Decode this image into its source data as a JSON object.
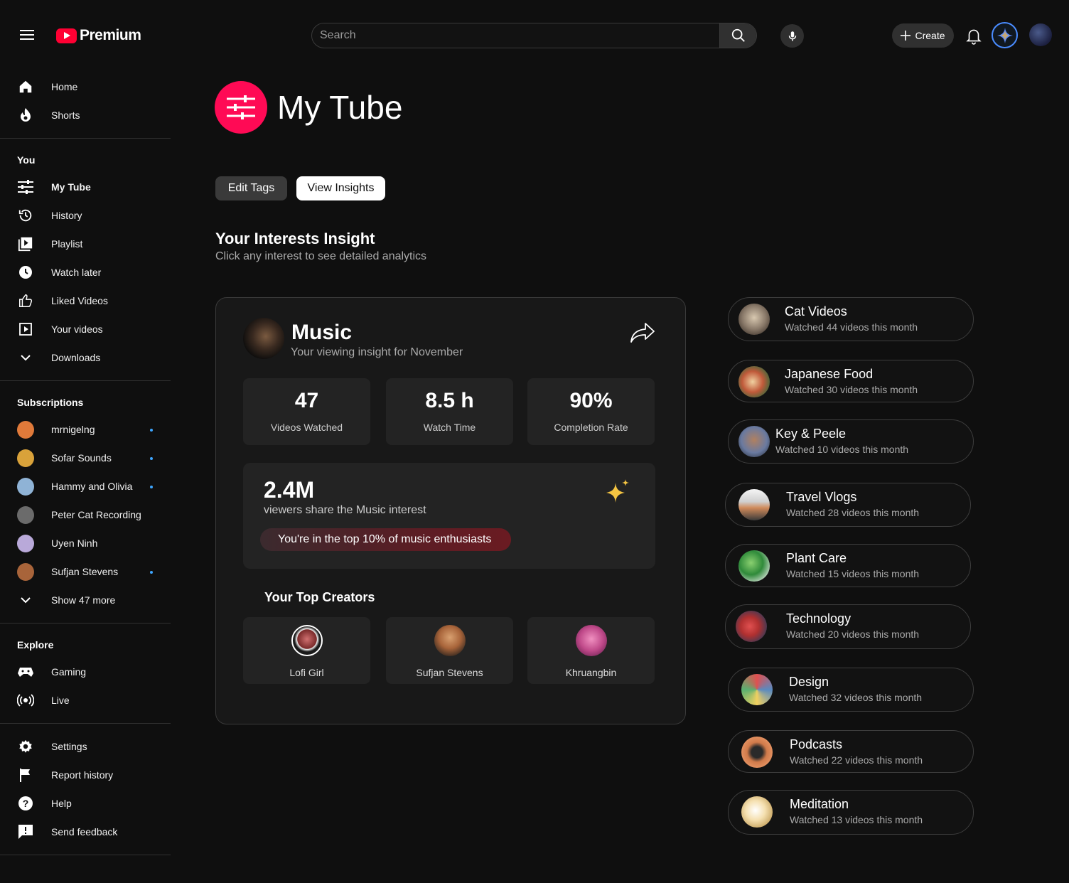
{
  "topbar": {
    "brand": "Premium",
    "search_placeholder": "Search",
    "create_label": "Create"
  },
  "sidebar": {
    "top": [
      {
        "label": "Home",
        "icon": "home-icon"
      },
      {
        "label": "Shorts",
        "icon": "shorts-icon"
      }
    ],
    "you_title": "You",
    "you": [
      {
        "label": "My Tube",
        "icon": "sliders-icon",
        "active": true
      },
      {
        "label": "History",
        "icon": "history-icon"
      },
      {
        "label": "Playlist",
        "icon": "playlist-icon"
      },
      {
        "label": "Watch later",
        "icon": "clock-icon"
      },
      {
        "label": "Liked Videos",
        "icon": "thumbs-up-icon"
      },
      {
        "label": "Your videos",
        "icon": "your-videos-icon"
      },
      {
        "label": "Downloads",
        "icon": "chevron-down-icon"
      }
    ],
    "subs_title": "Subscriptions",
    "subscriptions": [
      {
        "label": "mrnigelng",
        "color": "#e07a3a",
        "new": true
      },
      {
        "label": "Sofar Sounds",
        "color": "#d9a23a",
        "new": true
      },
      {
        "label": "Hammy and Olivia",
        "color": "#8fb3d6",
        "new": true
      },
      {
        "label": "Peter Cat Recording",
        "color": "#6b6b6b",
        "new": false
      },
      {
        "label": "Uyen Ninh",
        "color": "#b9a9d9",
        "new": false
      },
      {
        "label": "Sufjan Stevens",
        "color": "#a8643a",
        "new": true
      }
    ],
    "show_more": "Show 47 more",
    "explore_title": "Explore",
    "explore": [
      {
        "label": "Gaming",
        "icon": "gamepad-icon"
      },
      {
        "label": "Live",
        "icon": "live-icon"
      }
    ],
    "bottom": [
      {
        "label": "Settings",
        "icon": "gear-icon"
      },
      {
        "label": "Report history",
        "icon": "flag-icon"
      },
      {
        "label": "Help",
        "icon": "help-icon"
      },
      {
        "label": "Send feedback",
        "icon": "feedback-icon"
      }
    ]
  },
  "main": {
    "title": "My Tube",
    "edit_tags": "Edit Tags",
    "view_insights": "View Insights",
    "section_title": "Your Interests Insight",
    "section_sub": "Click any interest to see detailed analytics",
    "card": {
      "title": "Music",
      "subtitle": "Your viewing insight for November",
      "stats": [
        {
          "value": "47",
          "label": "Videos Watched"
        },
        {
          "value": "8.5 h",
          "label": "Watch Time"
        },
        {
          "value": "90%",
          "label": "Completion Rate"
        }
      ],
      "viewers_count": "2.4M",
      "viewers_desc": "viewers share the Music interest",
      "badge": "You're in the top 10% of music enthusiasts",
      "creators_title": "Your Top Creators",
      "creators": [
        {
          "name": "Lofi Girl",
          "color": "#7a2a2a"
        },
        {
          "name": "Sufjan Stevens",
          "color": "#a8643a"
        },
        {
          "name": "Khruangbin",
          "color": "#c04a8a"
        }
      ]
    },
    "interests": [
      {
        "title": "Cat Videos",
        "sub": "Watched 44 videos this month",
        "color": "#8a7a6a"
      },
      {
        "title": "Japanese Food",
        "sub": "Watched 30 videos this month",
        "color": "#c05a3a"
      },
      {
        "title": "Key & Peele",
        "sub": "Watched 10 videos this month",
        "color": "#6a7aa0"
      },
      {
        "title": "Travel Vlogs",
        "sub": "Watched 28 videos this month",
        "color": "#d08a5a"
      },
      {
        "title": "Plant Care",
        "sub": "Watched 15 videos this month",
        "color": "#2f8a3a"
      },
      {
        "title": "Technology",
        "sub": "Watched 20 videos this month",
        "color": "#b03030"
      },
      {
        "title": "Design",
        "sub": "Watched 32 videos this month",
        "color": "#5a8ac0"
      },
      {
        "title": "Podcasts",
        "sub": "Watched 22 videos this month",
        "color": "#d07a4a"
      },
      {
        "title": "Meditation",
        "sub": "Watched 13 videos this month",
        "color": "#d0b070"
      }
    ]
  },
  "colors": {
    "accent": "#ff0a55",
    "brand": "#ff0033",
    "link_dot": "#3ea6ff"
  }
}
